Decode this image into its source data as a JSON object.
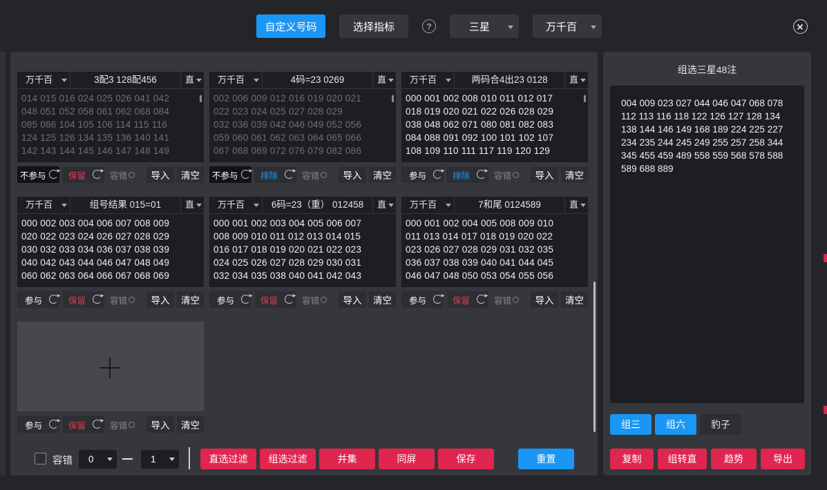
{
  "topbar": {
    "custom_number_label": "自定义号码",
    "select_indicator_label": "选择指标",
    "help_symbol": "?",
    "stars_select": "三星",
    "positions_select": "万千百"
  },
  "cards": [
    {
      "position": "万千百",
      "title": "3配3 128配456",
      "direction": "直",
      "numbers": "014 015 016 024 025 026 041 042\n048 051 052 058 061 062 068 084\n085 086 104 105 106 114 115 116\n124 125 126 134 135 136 140 141\n142 143 144 145 146 147 148 149",
      "participate": "不参与",
      "keep": "保留",
      "tolerance": "容错",
      "import": "导入",
      "clear": "清空"
    },
    {
      "position": "万千百",
      "title": "4码=23 0269",
      "direction": "直",
      "numbers": "002 006 009 012 016 019 020 021\n022 023 024 025 027 028 029\n032 036 039 042 046 049 052 056\n059 060 061 062 063 064 065 066\n067 068 069 072 076 079 082 086",
      "participate": "不参与",
      "keep": "排除",
      "tolerance": "容错",
      "import": "导入",
      "clear": "清空"
    },
    {
      "position": "万千百",
      "title": "两码合4出23 0128",
      "direction": "直",
      "numbers": "000 001 002 008 010 011 012 017\n018 019 020 021 022 026 028 029\n038 048 062 071 080 081 082 083\n084 088 091 092 100 101 102 107\n108 109 110 111 117 119 120 129",
      "participate": "参与",
      "keep": "排除",
      "tolerance": "容错",
      "import": "导入",
      "clear": "清空"
    },
    {
      "position": "万千百",
      "title": "组号结果 015=01",
      "direction": "直",
      "numbers": "000 002 003 004 006 007 008 009\n020 022 023 024 026 027 028 029\n030 032 033 034 036 037 038 039\n040 042 043 044 046 047 048 049\n060 062 063 064 066 067 068 069",
      "participate": "参与",
      "keep": "保留",
      "tolerance": "容错",
      "import": "导入",
      "clear": "清空"
    },
    {
      "position": "万千百",
      "title": "6码=23（重） 012458",
      "direction": "直",
      "numbers": "000 001 002 003 004 005 006 007\n008 009 010 011 012 013 014 015\n016 017 018 019 020 021 022 023\n024 025 026 027 028 029 030 031\n032 034 035 038 040 041 042 043",
      "participate": "参与",
      "keep": "保留",
      "tolerance": "容错",
      "import": "导入",
      "clear": "清空"
    },
    {
      "position": "万千百",
      "title": "7和尾 0124589",
      "direction": "直",
      "numbers": "000 001 002 004 005 008 009 010\n011 013 014 017 018 019 020 022\n023 026 027 028 029 031 032 035\n036 037 038 039 040 041 044 045\n046 047 048 050 053 054 055 056",
      "participate": "参与",
      "keep": "保留",
      "tolerance": "容错",
      "import": "导入",
      "clear": "清空"
    }
  ],
  "new_card": {
    "participate": "参与",
    "keep": "保留",
    "tolerance": "容错",
    "import": "导入",
    "clear": "清空"
  },
  "bottom": {
    "tolerance_label": "容错",
    "from_value": "0",
    "dash": "—",
    "to_value": "1",
    "direct_filter": "直选过滤",
    "group_filter": "组选过滤",
    "union": "并集",
    "same_screen": "同屏",
    "save": "保存",
    "reset": "重置"
  },
  "result": {
    "title": "组选三星48注",
    "numbers": "004 009 023 027 044 046 047 068 078\n112 113 116 118 122 126 127 128 134\n138 144 146 149 168 189 224 225 227\n234 235 244 245 249 255 257 258 344\n345 455 459 489 558 559 568 578 588\n589 688 889",
    "tab_group3": "组三",
    "tab_group6": "组六",
    "tab_leopard": "豹子",
    "copy": "复制",
    "to_direct": "组转直",
    "trend": "趋势",
    "export": "导出"
  },
  "colors": {
    "accent_blue": "#1a97f5",
    "accent_red": "#e0254f",
    "panel": "#35373c",
    "background": "#242529"
  }
}
